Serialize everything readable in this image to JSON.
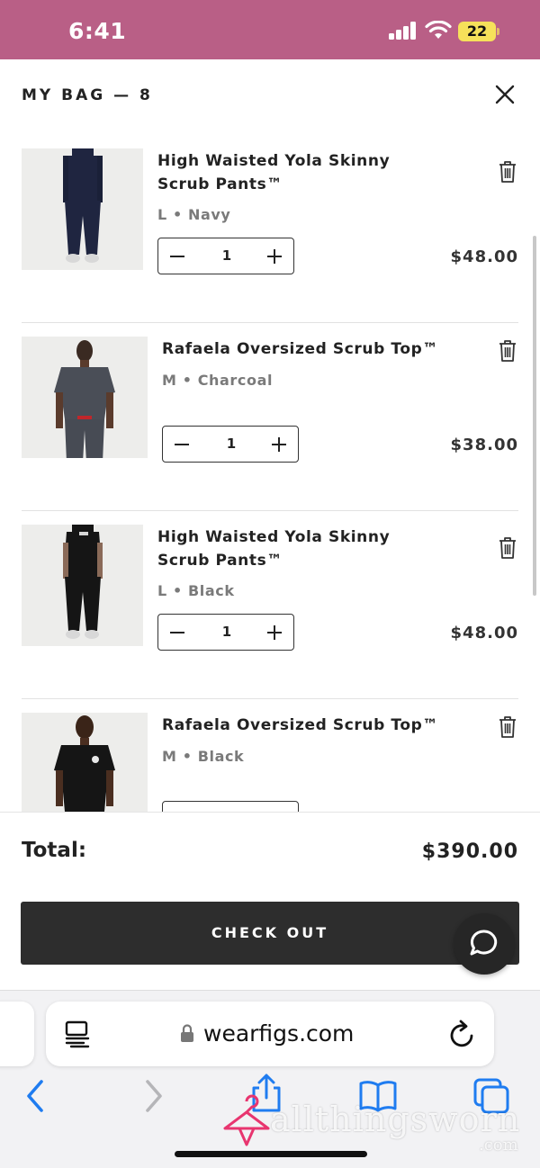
{
  "status_bar": {
    "time": "6:41",
    "battery": "22"
  },
  "bag": {
    "title": "MY BAG — 8"
  },
  "items": [
    {
      "name": "High Waisted Yola Skinny Scrub Pants™",
      "variant": "L • Navy",
      "quantity": "1",
      "price": "$48.00",
      "image": "navy-scrub-pants-photo",
      "color": "#1f2540"
    },
    {
      "name": "Rafaela Oversized Scrub Top™",
      "variant": "M • Charcoal",
      "quantity": "1",
      "price": "$38.00",
      "image": "charcoal-scrub-top-photo",
      "color": "#4a4e57"
    },
    {
      "name": "High Waisted Yola Skinny Scrub Pants™",
      "variant": "L • Black",
      "quantity": "1",
      "price": "$48.00",
      "image": "black-scrub-pants-photo",
      "color": "#151515"
    },
    {
      "name": "Rafaela Oversized Scrub Top™",
      "variant": "M • Black",
      "quantity": "",
      "price": "",
      "image": "black-scrub-top-photo",
      "color": "#151515"
    }
  ],
  "summary": {
    "total_label": "Total:",
    "total_value": "$390.00",
    "checkout_label": "CHECK OUT"
  },
  "browser": {
    "url": "wearfigs.com"
  },
  "watermark": {
    "text": "allthingsworn",
    "suffix": ".com"
  },
  "colors": {
    "status_bar": "#b95f86",
    "checkout_button": "#2d2d2d",
    "ios_blue": "#1f7cf0"
  }
}
